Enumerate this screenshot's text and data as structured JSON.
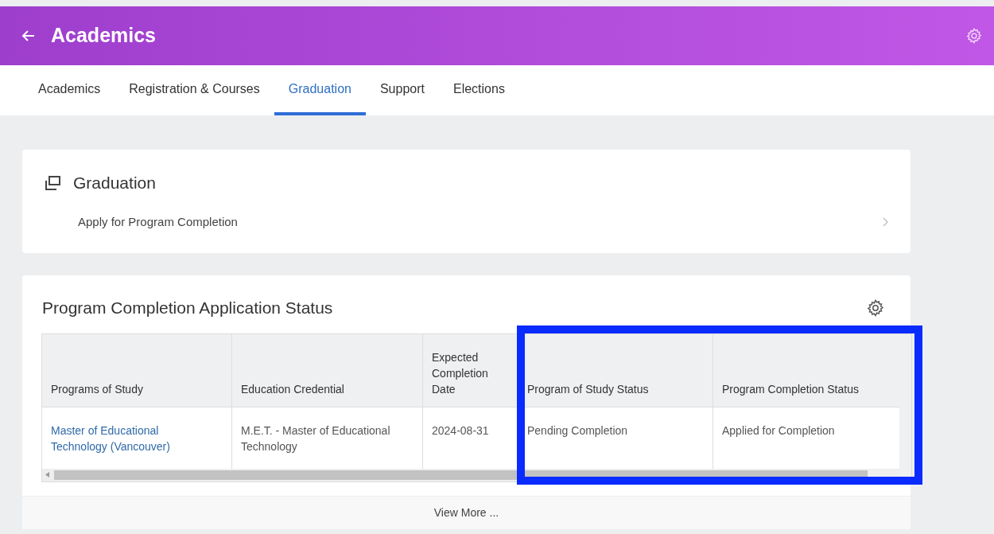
{
  "header": {
    "title": "Academics"
  },
  "tabs": [
    {
      "label": "Academics",
      "selected": false
    },
    {
      "label": "Registration & Courses",
      "selected": false
    },
    {
      "label": "Graduation",
      "selected": true
    },
    {
      "label": "Support",
      "selected": false
    },
    {
      "label": "Elections",
      "selected": false
    }
  ],
  "graduation_card": {
    "title": "Graduation",
    "link": "Apply for Program Completion"
  },
  "status_card": {
    "title": "Program Completion Application Status",
    "table": {
      "columns": [
        {
          "label": "Programs of Study",
          "highlighted": false
        },
        {
          "label": "Education Credential",
          "highlighted": false
        },
        {
          "label": "Expected Completion Date",
          "highlighted": false
        },
        {
          "label": "Program of Study Status",
          "highlighted": true
        },
        {
          "label": "Program Completion Status",
          "highlighted": true
        }
      ],
      "rows": [
        [
          {
            "text": "Master of Educational Technology (Vancouver)",
            "kind": "link"
          },
          {
            "text": "M.E.T. - Master of Educational Technology",
            "kind": "text"
          },
          {
            "text": "2024-08-31",
            "kind": "text"
          },
          {
            "text": "Pending Completion",
            "kind": "text"
          },
          {
            "text": "Applied for Completion",
            "kind": "text"
          }
        ]
      ]
    },
    "footer_link": "View More ..."
  }
}
